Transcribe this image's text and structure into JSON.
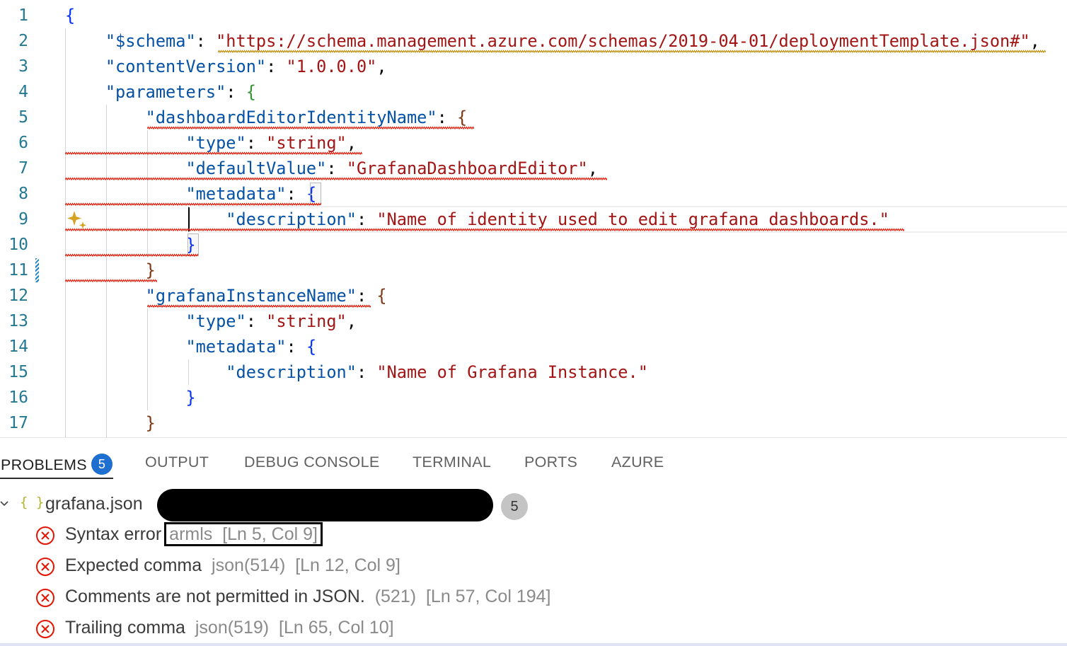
{
  "editor": {
    "line_numbers": [
      "1",
      "2",
      "3",
      "4",
      "5",
      "6",
      "7",
      "8",
      "9",
      "10",
      "11",
      "12",
      "13",
      "14",
      "15",
      "16",
      "17"
    ],
    "lines": [
      {
        "n": 1,
        "tokens": [
          {
            "t": "{",
            "c": "b1"
          }
        ]
      },
      {
        "n": 2,
        "tokens": [
          {
            "t": "    ",
            "c": "p"
          },
          {
            "t": "\"$schema\"",
            "c": "k"
          },
          {
            "t": ": ",
            "c": "p"
          },
          {
            "t": "\"https://schema.management.azure.com/schemas/2019-04-01/deploymentTemplate.json#\"",
            "c": "s"
          },
          {
            "t": ",",
            "c": "p"
          }
        ]
      },
      {
        "n": 3,
        "tokens": [
          {
            "t": "    ",
            "c": "p"
          },
          {
            "t": "\"contentVersion\"",
            "c": "k"
          },
          {
            "t": ": ",
            "c": "p"
          },
          {
            "t": "\"1.0.0.0\"",
            "c": "s"
          },
          {
            "t": ",",
            "c": "p"
          }
        ]
      },
      {
        "n": 4,
        "tokens": [
          {
            "t": "    ",
            "c": "p"
          },
          {
            "t": "\"parameters\"",
            "c": "k"
          },
          {
            "t": ": ",
            "c": "p"
          },
          {
            "t": "{",
            "c": "b2"
          }
        ]
      },
      {
        "n": 5,
        "tokens": [
          {
            "t": "        ",
            "c": "p"
          },
          {
            "t": "\"dashboardEditorIdentityName\"",
            "c": "k"
          },
          {
            "t": ": ",
            "c": "p"
          },
          {
            "t": "{",
            "c": "b3"
          }
        ]
      },
      {
        "n": 6,
        "tokens": [
          {
            "t": "            ",
            "c": "p"
          },
          {
            "t": "\"type\"",
            "c": "k"
          },
          {
            "t": ": ",
            "c": "p"
          },
          {
            "t": "\"string\"",
            "c": "s"
          },
          {
            "t": ",",
            "c": "p"
          }
        ]
      },
      {
        "n": 7,
        "tokens": [
          {
            "t": "            ",
            "c": "p"
          },
          {
            "t": "\"defaultValue\"",
            "c": "k"
          },
          {
            "t": ": ",
            "c": "p"
          },
          {
            "t": "\"GrafanaDashboardEditor\"",
            "c": "s"
          },
          {
            "t": ",",
            "c": "p"
          }
        ]
      },
      {
        "n": 8,
        "tokens": [
          {
            "t": "            ",
            "c": "p"
          },
          {
            "t": "\"metadata\"",
            "c": "k"
          },
          {
            "t": ": ",
            "c": "p"
          },
          {
            "t": "{",
            "c": "b1"
          }
        ]
      },
      {
        "n": 9,
        "tokens": [
          {
            "t": "                ",
            "c": "p"
          },
          {
            "t": "\"description\"",
            "c": "k"
          },
          {
            "t": ": ",
            "c": "p"
          },
          {
            "t": "\"Name of identity used to edit grafana dashboards.\"",
            "c": "s"
          }
        ]
      },
      {
        "n": 10,
        "tokens": [
          {
            "t": "            ",
            "c": "p"
          },
          {
            "t": "}",
            "c": "b1"
          }
        ]
      },
      {
        "n": 11,
        "tokens": [
          {
            "t": "        ",
            "c": "p"
          },
          {
            "t": "}",
            "c": "b3"
          }
        ]
      },
      {
        "n": 12,
        "tokens": [
          {
            "t": "        ",
            "c": "p"
          },
          {
            "t": "\"grafanaInstanceName\"",
            "c": "k"
          },
          {
            "t": ": ",
            "c": "p"
          },
          {
            "t": "{",
            "c": "b3"
          }
        ]
      },
      {
        "n": 13,
        "tokens": [
          {
            "t": "            ",
            "c": "p"
          },
          {
            "t": "\"type\"",
            "c": "k"
          },
          {
            "t": ": ",
            "c": "p"
          },
          {
            "t": "\"string\"",
            "c": "s"
          },
          {
            "t": ",",
            "c": "p"
          }
        ]
      },
      {
        "n": 14,
        "tokens": [
          {
            "t": "            ",
            "c": "p"
          },
          {
            "t": "\"metadata\"",
            "c": "k"
          },
          {
            "t": ": ",
            "c": "p"
          },
          {
            "t": "{",
            "c": "b1"
          }
        ]
      },
      {
        "n": 15,
        "tokens": [
          {
            "t": "                ",
            "c": "p"
          },
          {
            "t": "\"description\"",
            "c": "k"
          },
          {
            "t": ": ",
            "c": "p"
          },
          {
            "t": "\"Name of Grafana Instance.\"",
            "c": "s"
          }
        ]
      },
      {
        "n": 16,
        "tokens": [
          {
            "t": "            ",
            "c": "p"
          },
          {
            "t": "}",
            "c": "b1"
          }
        ]
      },
      {
        "n": 17,
        "tokens": [
          {
            "t": "        ",
            "c": "p"
          },
          {
            "t": "}",
            "c": "b3"
          }
        ]
      }
    ]
  },
  "colors": {
    "keyword": "#0451a5",
    "string": "#a31515",
    "error_squiggle": "#e51400",
    "warning_squiggle": "#bf8803",
    "line_number": "#237893",
    "badge": "#1f6fd0",
    "error_icon": "#e51400"
  },
  "panel": {
    "tabs": [
      {
        "label": "PROBLEMS",
        "active": true
      },
      {
        "label": "OUTPUT"
      },
      {
        "label": "DEBUG CONSOLE"
      },
      {
        "label": "TERMINAL"
      },
      {
        "label": "PORTS"
      },
      {
        "label": "AZURE"
      }
    ],
    "problems_badge": "5",
    "file": {
      "icon": "{ }",
      "name": "grafana.json",
      "count": "5"
    },
    "problems": [
      {
        "message": "Syntax error",
        "source": "armls",
        "location": "[Ln 5, Col 9]"
      },
      {
        "message": "Expected comma",
        "source": "json(514)",
        "location": "[Ln 12, Col 9]"
      },
      {
        "message": "Comments are not permitted in JSON.",
        "source": "(521)",
        "location": "[Ln 57, Col 194]"
      },
      {
        "message": "Trailing comma",
        "source": "json(519)",
        "location": "[Ln 65, Col 10]"
      }
    ]
  },
  "icons": {
    "sparkle": "sparkle-icon",
    "error": "error-circle-icon",
    "chevron": "chevron-down-icon",
    "json_file": "json-file-icon"
  }
}
